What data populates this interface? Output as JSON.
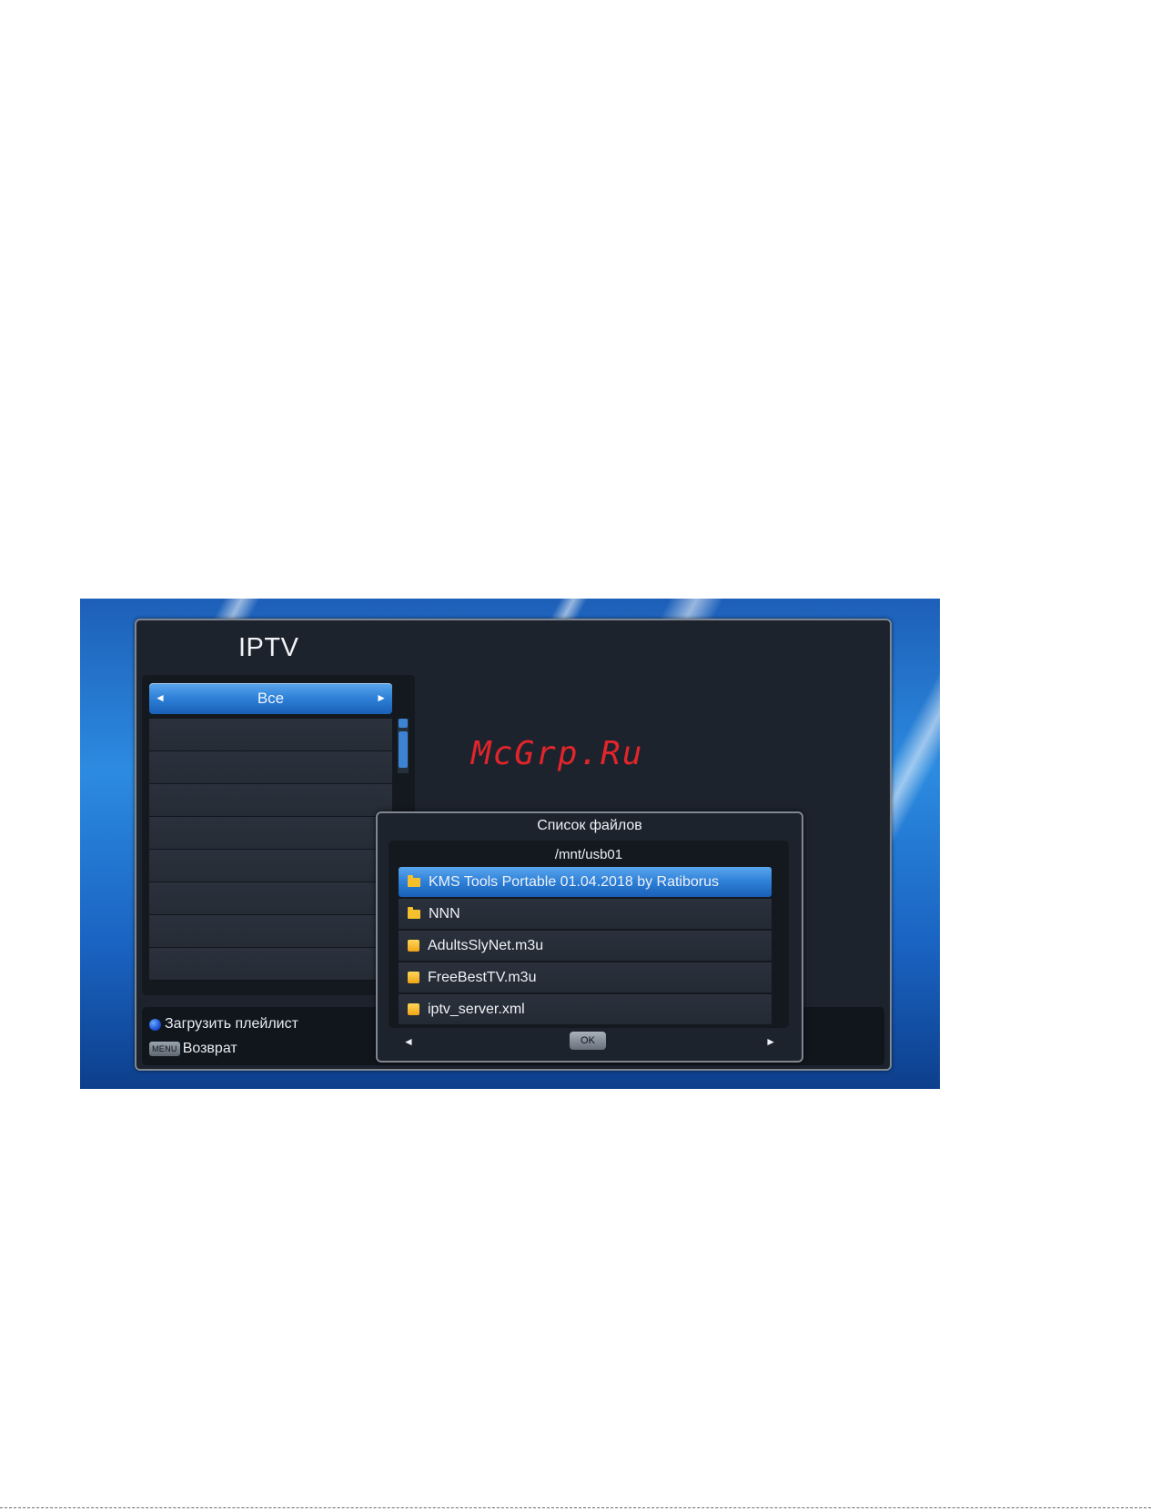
{
  "iptv": {
    "title": "IPTV",
    "group_selector": {
      "value": "Все"
    },
    "channel_rows": [
      "",
      "",
      "",
      "",
      "",
      "",
      "",
      ""
    ]
  },
  "watermark": "McGrp.Ru",
  "hints": {
    "load_playlist": "Загрузить плейлист",
    "menu_key": "MENU",
    "back": "Возврат"
  },
  "file_dialog": {
    "title": "Список файлов",
    "path": "/mnt/usb01",
    "items": [
      {
        "name": "KMS Tools Portable 01.04.2018 by Ratiborus",
        "type": "folder",
        "selected": true
      },
      {
        "name": "NNN",
        "type": "folder",
        "selected": false
      },
      {
        "name": "AdultsSlyNet.m3u",
        "type": "file",
        "selected": false
      },
      {
        "name": "FreeBestTV.m3u",
        "type": "file",
        "selected": false
      },
      {
        "name": "iptv_server.xml",
        "type": "file",
        "selected": false
      }
    ],
    "ok_label": "OK"
  },
  "colors": {
    "selection": "#2d7fd7",
    "panel_bg": "#1d232d",
    "folder": "#f5c02c",
    "watermark": "#e2252b",
    "blue_key": "#1d53d6"
  }
}
